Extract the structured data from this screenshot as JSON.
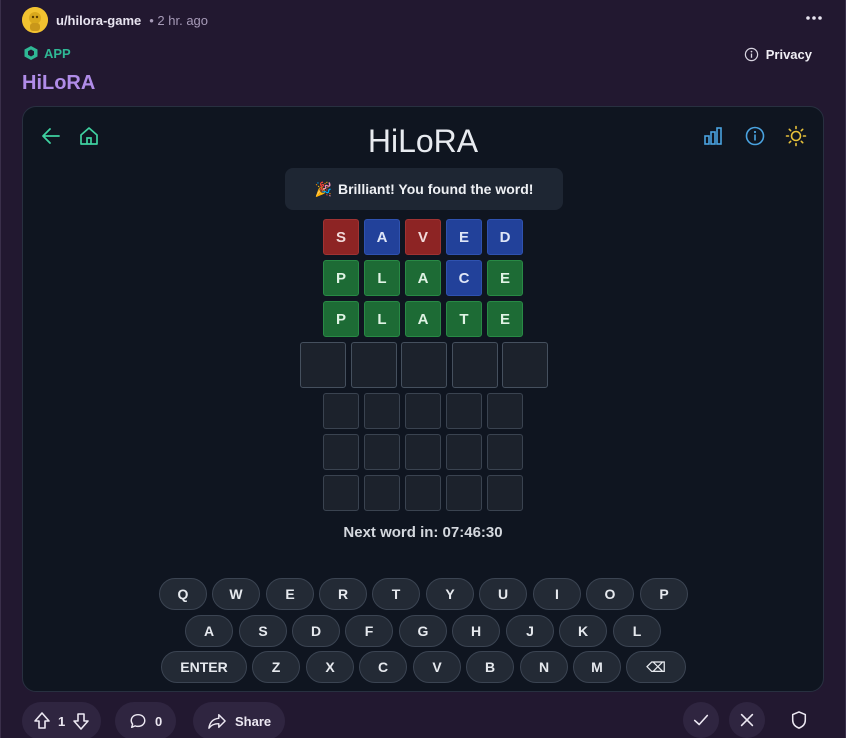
{
  "post": {
    "username": "u/hilora-game",
    "timestamp": "• 2 hr. ago",
    "app_label": "APP",
    "privacy_label": "Privacy",
    "title": "HiLoRA"
  },
  "game": {
    "title": "HiLoRA",
    "toast_emoji": "🎉",
    "toast_text": "Brilliant! You found the word!",
    "countdown": "Next word in: 07:46:30",
    "guesses": [
      [
        {
          "l": "S",
          "s": "red"
        },
        {
          "l": "A",
          "s": "blue"
        },
        {
          "l": "V",
          "s": "red"
        },
        {
          "l": "E",
          "s": "blue"
        },
        {
          "l": "D",
          "s": "blue"
        }
      ],
      [
        {
          "l": "P",
          "s": "green"
        },
        {
          "l": "L",
          "s": "green"
        },
        {
          "l": "A",
          "s": "green"
        },
        {
          "l": "C",
          "s": "blue"
        },
        {
          "l": "E",
          "s": "green"
        }
      ],
      [
        {
          "l": "P",
          "s": "green"
        },
        {
          "l": "L",
          "s": "green"
        },
        {
          "l": "A",
          "s": "green"
        },
        {
          "l": "T",
          "s": "green"
        },
        {
          "l": "E",
          "s": "green"
        }
      ]
    ],
    "keyboard": {
      "row1": [
        "Q",
        "W",
        "E",
        "R",
        "T",
        "Y",
        "U",
        "I",
        "O",
        "P"
      ],
      "row2": [
        "A",
        "S",
        "D",
        "F",
        "G",
        "H",
        "J",
        "K",
        "L"
      ],
      "row3": [
        "ENTER",
        "Z",
        "X",
        "C",
        "V",
        "B",
        "N",
        "M",
        "⌫"
      ]
    }
  },
  "footer": {
    "votes": "1",
    "comments": "0",
    "share_label": "Share"
  },
  "colors": {
    "background": "#221830",
    "card": "#0f1520",
    "accent_green": "#2fb895",
    "title_purple": "#b08ce8",
    "tile_red": "#8d2424",
    "tile_blue": "#22419a",
    "tile_green": "#1d6b35"
  }
}
